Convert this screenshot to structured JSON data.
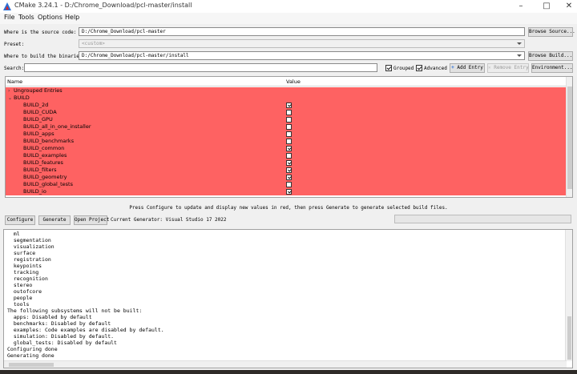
{
  "window": {
    "title": "CMake 3.24.1 - D:/Chrome_Download/pcl-master/install"
  },
  "menu": [
    "File",
    "Tools",
    "Options",
    "Help"
  ],
  "source": {
    "label": "Where is the source code:",
    "value": "D:/Chrome_Download/pcl-master",
    "button": "Browse Source..."
  },
  "preset": {
    "label": "Preset:",
    "value": "<custom>"
  },
  "binaries": {
    "label": "Where to build the binaries:",
    "value": "D:/Chrome_Download/pcl-master/install",
    "button": "Browse Build..."
  },
  "search": {
    "label": "Search:",
    "value": "",
    "grouped_label": "Grouped",
    "grouped": true,
    "advanced_label": "Advanced",
    "advanced": true,
    "add_entry": "Add Entry",
    "remove_entry": "Remove Entry",
    "environment": "Environment..."
  },
  "table": {
    "headers": {
      "name": "Name",
      "value": "Value"
    },
    "groups": [
      {
        "name": "Ungrouped Entries",
        "expanded": false
      },
      {
        "name": "BUILD",
        "expanded": true
      }
    ],
    "rows": [
      {
        "name": "BUILD_2d",
        "checked": true
      },
      {
        "name": "BUILD_CUDA",
        "checked": false
      },
      {
        "name": "BUILD_GPU",
        "checked": false
      },
      {
        "name": "BUILD_all_in_one_installer",
        "checked": false
      },
      {
        "name": "BUILD_apps",
        "checked": false
      },
      {
        "name": "BUILD_benchmarks",
        "checked": false
      },
      {
        "name": "BUILD_common",
        "checked": true
      },
      {
        "name": "BUILD_examples",
        "checked": false
      },
      {
        "name": "BUILD_features",
        "checked": true
      },
      {
        "name": "BUILD_filters",
        "checked": true
      },
      {
        "name": "BUILD_geometry",
        "checked": true
      },
      {
        "name": "BUILD_global_tests",
        "checked": false
      },
      {
        "name": "BUILD_io",
        "checked": true
      }
    ]
  },
  "hint": "Press Configure to update and display new values in red, then press Generate to generate selected build files.",
  "actions": {
    "configure": "Configure",
    "generate": "Generate",
    "open_project": "Open Project",
    "generator": "Current Generator: Visual Studio 17 2022"
  },
  "output": [
    "  ml",
    "  segmentation",
    "  visualization",
    "  surface",
    "  registration",
    "  keypoints",
    "  tracking",
    "  recognition",
    "  stereo",
    "  outofcore",
    "  people",
    "  tools",
    "The following subsystems will not be built:",
    "  apps: Disabled by default",
    "  benchmarks: Disabled by default",
    "  examples: Code examples are disabled by default.",
    "  simulation: Disabled by default.",
    "  global_tests: Disabled by default",
    "Configuring done",
    "Generating done"
  ],
  "colors": {
    "changed_row": "#fe6262",
    "accent": "#2a6fd6"
  }
}
